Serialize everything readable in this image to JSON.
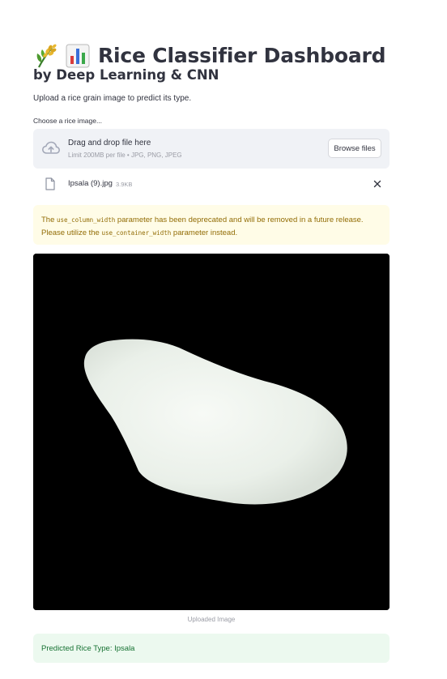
{
  "header": {
    "title": "Rice Classifier Dashboard",
    "icons": [
      "rice-plant-icon",
      "bar-chart-icon"
    ],
    "subtitle": "by Deep Learning & CNN",
    "description": "Upload a rice grain image to predict its type."
  },
  "uploader": {
    "label": "Choose a rice image...",
    "drop_text": "Drag and drop file here",
    "limit_text": "Limit 200MB per file • JPG, PNG, JPEG",
    "browse_label": "Browse files",
    "upload_icon": "cloud-upload-icon"
  },
  "file": {
    "name": "Ipsala (9).jpg",
    "size": "3.9KB",
    "file_icon": "file-icon",
    "remove_icon": "close-icon"
  },
  "warning": {
    "text_1": "The ",
    "code_1": "use_column_width",
    "text_2": " parameter has been deprecated and will be removed in a future release. Please utilize the ",
    "code_2": "use_container_width",
    "text_3": " parameter instead."
  },
  "image": {
    "caption": "Uploaded Image"
  },
  "result": {
    "text": "Predicted Rice Type: Ipsala"
  },
  "colors": {
    "text": "#31333f",
    "dropzone_bg": "#f0f2f6",
    "warning_bg": "#fffce7",
    "warning_text": "#926c05",
    "success_bg": "#ecf9ef",
    "success_text": "#177233",
    "muted": "#9a9ca5"
  }
}
